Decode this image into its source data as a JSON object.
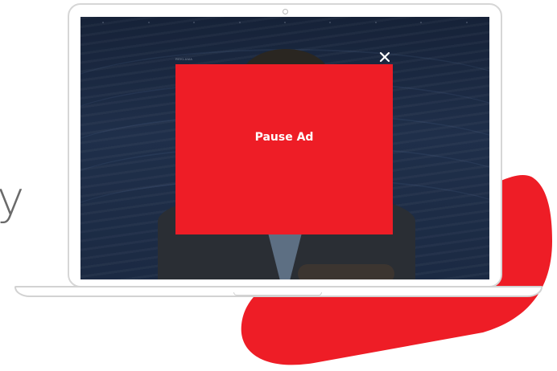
{
  "ad": {
    "label": "REKLAMA",
    "text": "Pause Ad",
    "close_symbol": "✕",
    "color": "#ee1d26"
  },
  "decor": {
    "stray_glyph": "y",
    "blob_color": "#ee1d26",
    "close_icon": "close-icon"
  }
}
